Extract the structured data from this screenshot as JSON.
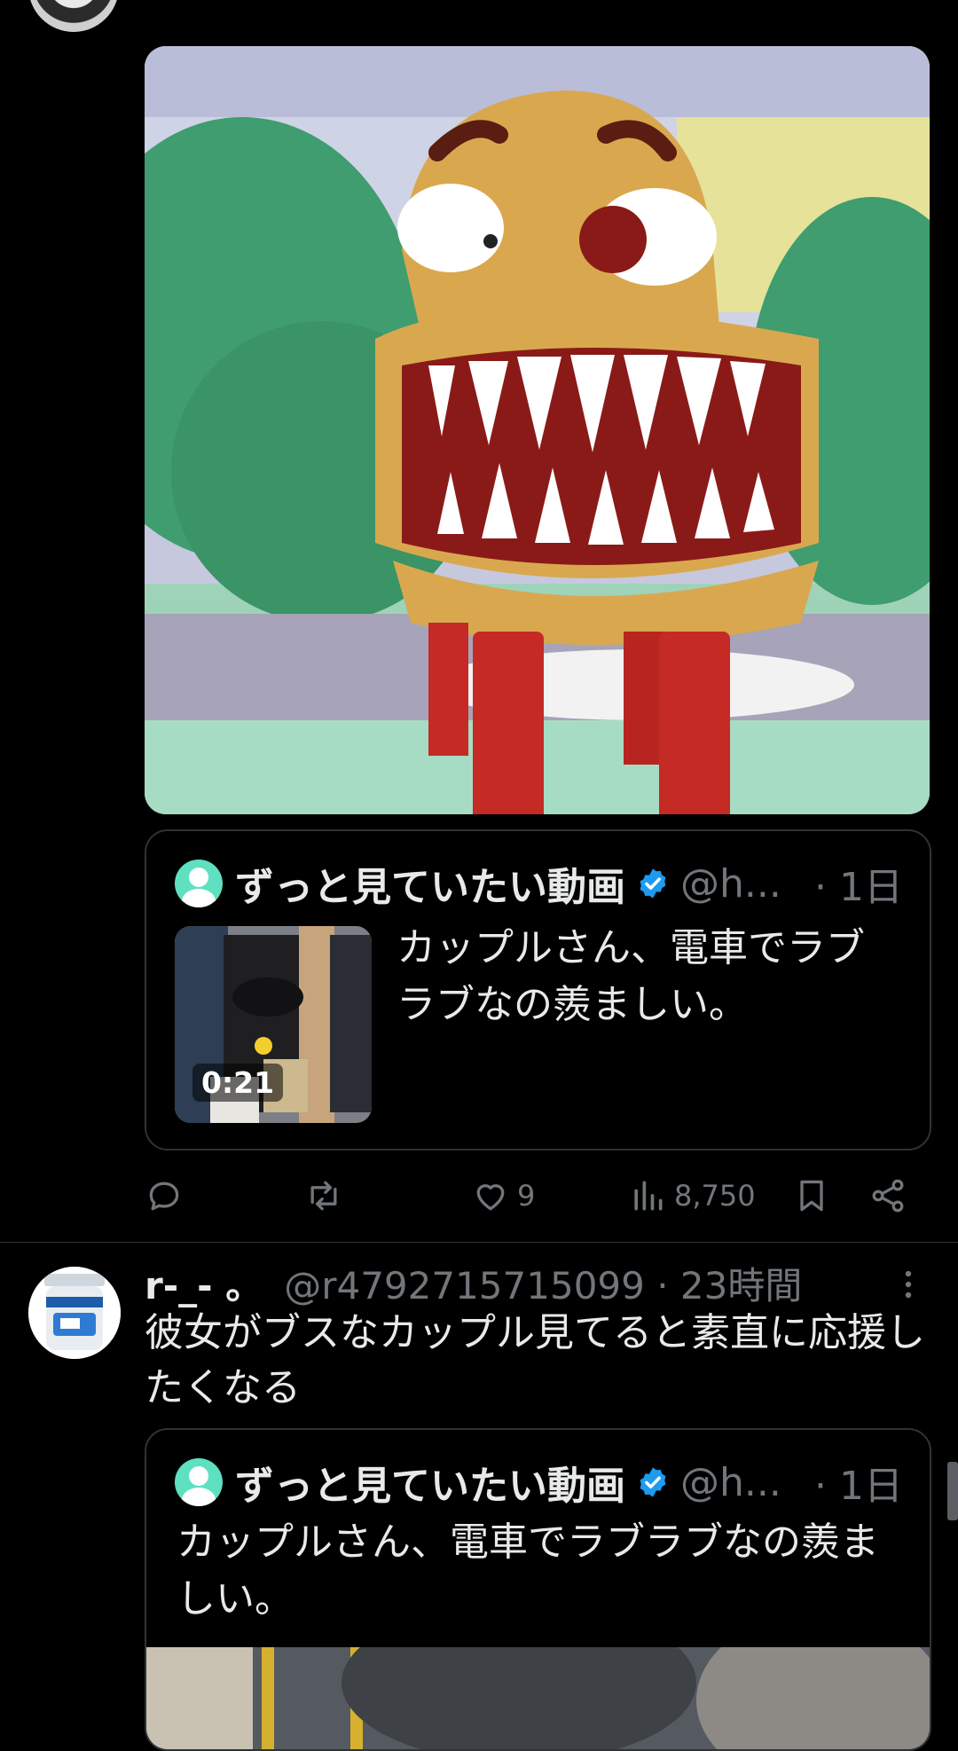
{
  "tweet1": {
    "quote": {
      "name": "ずっと見ていたい動画",
      "handle": "@h...",
      "time": "· 1日",
      "text": "カップルさん、電車でラブラブなの羨ましい。",
      "video_duration": "0:21"
    },
    "actions": {
      "reply_count": "",
      "retweet_count": "",
      "like_count": "9",
      "view_count": "8,750"
    }
  },
  "tweet2": {
    "name": "r-_- 。",
    "handle": "@r4792715715099 · 23時間",
    "text": "彼女がブスなカップル見てると素直に応援したくなる",
    "quote": {
      "name": "ずっと見ていたい動画",
      "handle": "@h...",
      "time": "· 1日",
      "text": "カップルさん、電車でラブラブなの羨ましい。"
    }
  },
  "icons": {
    "reply": "reply-icon",
    "retweet": "retweet-icon",
    "like": "heart-icon",
    "views": "views-icon",
    "bookmark": "bookmark-icon",
    "share": "share-icon",
    "verified": "verified-badge-icon",
    "more": "more-icon"
  },
  "colors": {
    "background": "#000000",
    "text": "#e7e9ea",
    "secondary": "#71767b",
    "verified": "#1d9bf0",
    "border": "#2f3336"
  }
}
